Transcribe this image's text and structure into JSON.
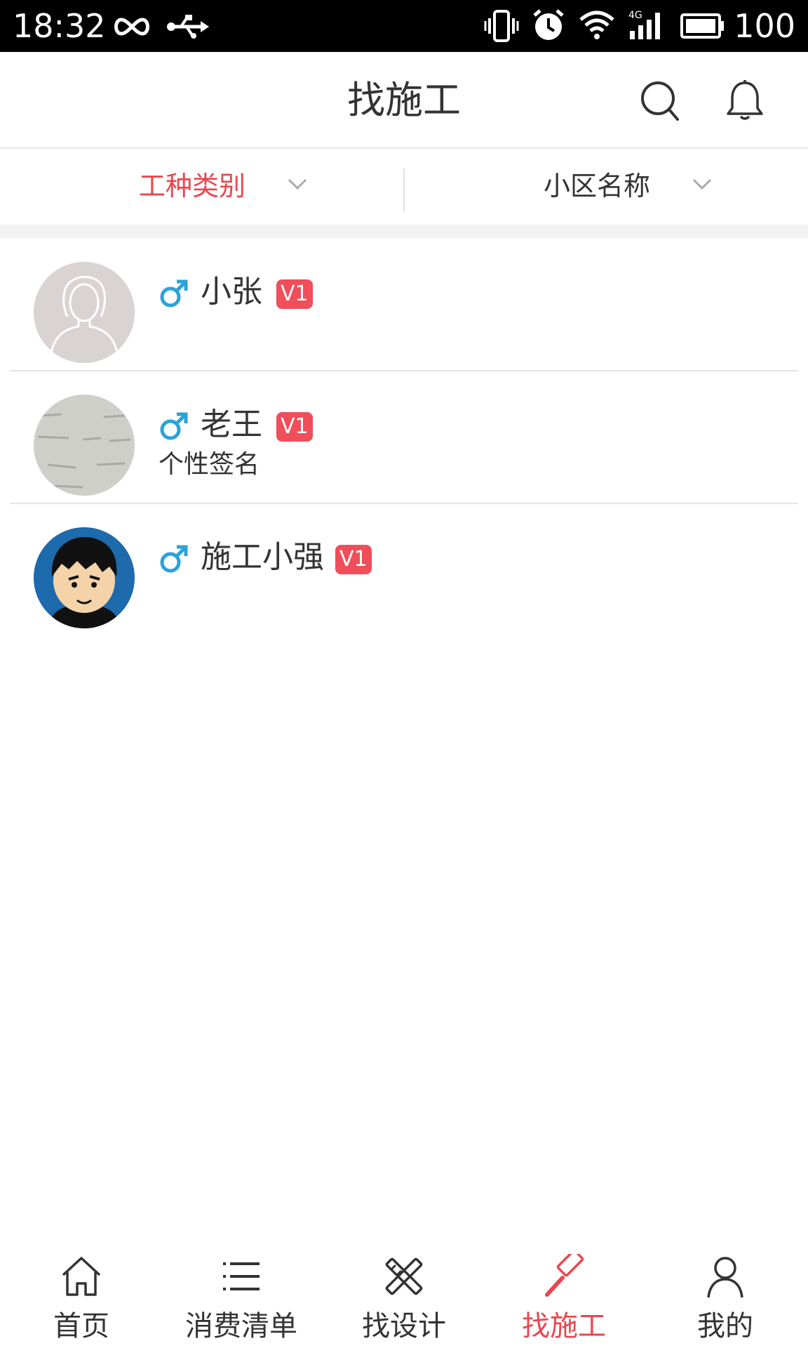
{
  "status_bar": {
    "time": "18:32",
    "battery": "100",
    "network": "4G",
    "icons": [
      "infinity-icon",
      "usb-icon",
      "vibrate-icon",
      "alarm-icon",
      "wifi-icon",
      "signal-icon",
      "battery-icon"
    ]
  },
  "header": {
    "title": "找施工",
    "actions": [
      "search-icon",
      "bell-icon"
    ]
  },
  "filters": [
    {
      "label": "工种类别",
      "active": true
    },
    {
      "label": "小区名称",
      "active": false
    }
  ],
  "workers": [
    {
      "name": "小张",
      "gender": "male",
      "badge": "V1",
      "signature": ""
    },
    {
      "name": "老王",
      "gender": "male",
      "badge": "V1",
      "signature": "个性签名"
    },
    {
      "name": "施工小强",
      "gender": "male",
      "badge": "V1",
      "signature": ""
    }
  ],
  "bottom_nav": [
    {
      "label": "首页",
      "icon": "home-icon",
      "active": false
    },
    {
      "label": "消费清单",
      "icon": "list-icon",
      "active": false
    },
    {
      "label": "找设计",
      "icon": "design-tools-icon",
      "active": false
    },
    {
      "label": "找施工",
      "icon": "hammer-icon",
      "active": true
    },
    {
      "label": "我的",
      "icon": "user-icon",
      "active": false
    }
  ],
  "colors": {
    "accent": "#e8474f",
    "badge": "#ef4e5a",
    "male": "#29a3d9",
    "text": "#333333",
    "divider": "#e5e5e5"
  }
}
